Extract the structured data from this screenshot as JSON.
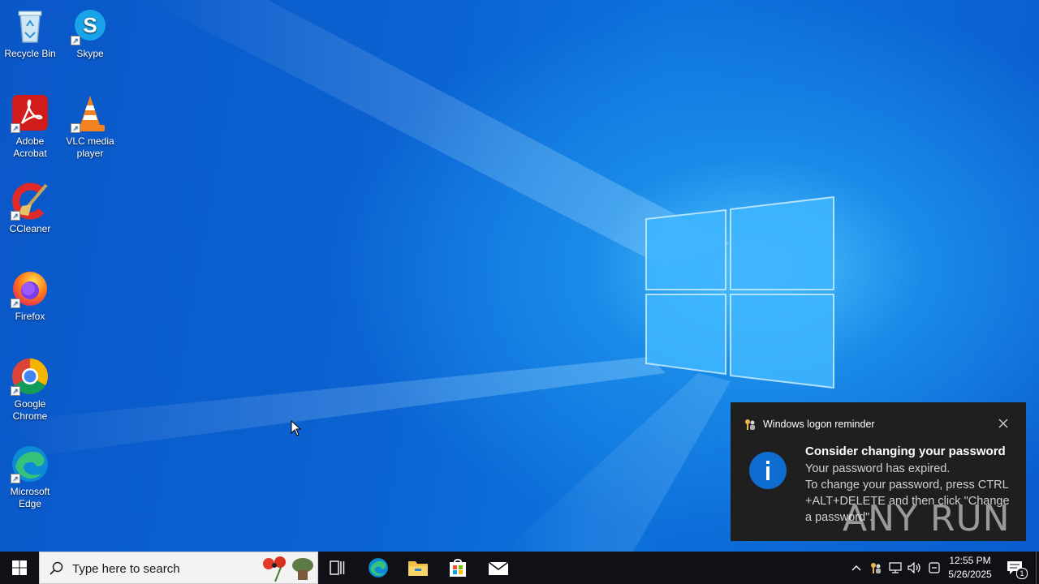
{
  "desktop": {
    "icons": [
      {
        "label": "Recycle Bin",
        "icon": "recycle-bin-icon"
      },
      {
        "label": "Skype",
        "icon": "skype-icon"
      },
      {
        "label": "Adobe Acrobat",
        "icon": "adobe-acrobat-icon"
      },
      {
        "label": "VLC media player",
        "icon": "vlc-icon"
      },
      {
        "label": "CCleaner",
        "icon": "ccleaner-icon"
      },
      {
        "label": "Firefox",
        "icon": "firefox-icon"
      },
      {
        "label": "Google Chrome",
        "icon": "chrome-icon"
      },
      {
        "label": "Microsoft Edge",
        "icon": "edge-icon"
      }
    ]
  },
  "taskbar": {
    "search_placeholder": "Type here to search",
    "pinned": [
      "task-view-icon",
      "edge-icon",
      "file-explorer-icon",
      "store-icon",
      "mail-icon"
    ],
    "clock": {
      "time": "12:55 PM",
      "date": "5/26/2025"
    },
    "notification_count": "1"
  },
  "toast": {
    "app_title": "Windows logon reminder",
    "heading": "Consider changing your password",
    "body": [
      "Your password has expired.",
      "To change your password, press CTRL +ALT+DELETE and then click \"Change a password\"."
    ],
    "watermark": "ANY RUN"
  },
  "colors": {
    "accent": "#0a73d9",
    "taskbar": "#0f1117",
    "toast_bg": "#1f1f1f",
    "info_blue": "#0f6cd0"
  }
}
